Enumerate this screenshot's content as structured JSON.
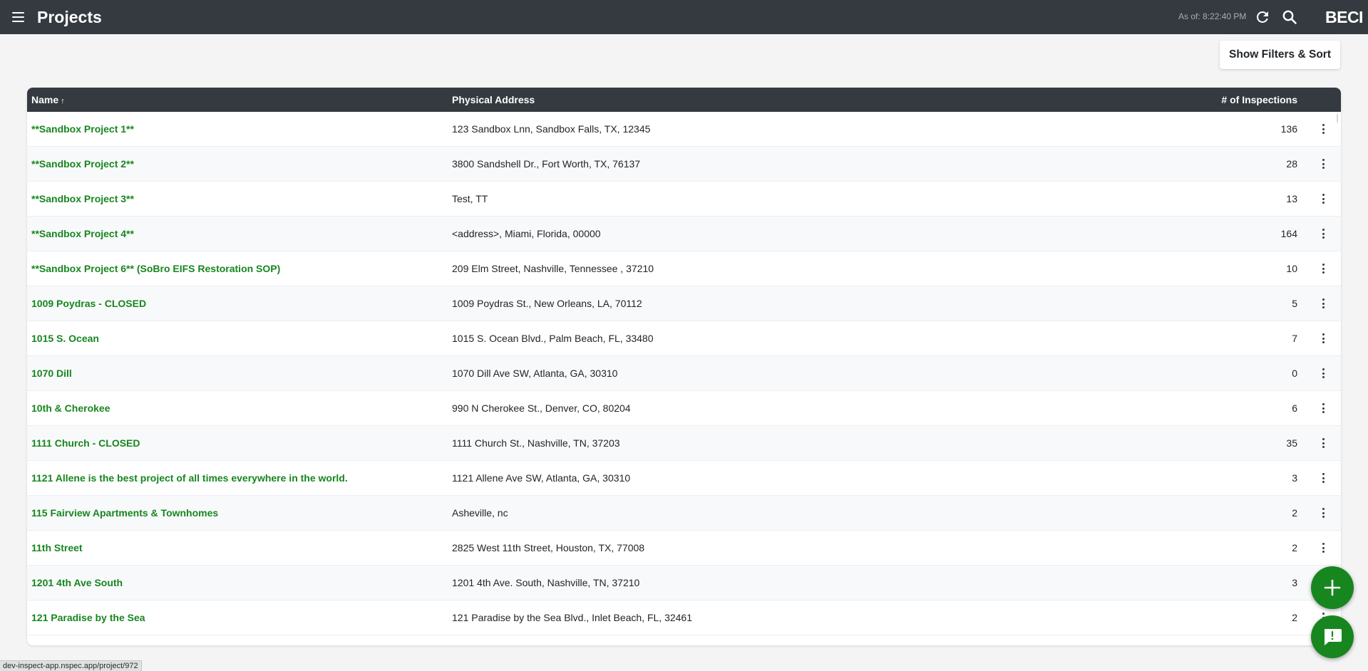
{
  "header": {
    "title": "Projects",
    "as_of": "As of: 8:22:40 PM",
    "brand": "BECI",
    "icons": {
      "menu": "hamburger-menu-icon",
      "refresh": "refresh-icon",
      "search": "search-icon"
    }
  },
  "toolbar": {
    "filters_label": "Show Filters & Sort"
  },
  "table": {
    "columns": {
      "name": "Name",
      "address": "Physical Address",
      "count": "# of Inspections"
    },
    "sort_indicator": "↑",
    "rows": [
      {
        "name": "**Sandbox Project 1**",
        "address": "123 Sandbox Lnn, Sandbox Falls, TX, 12345",
        "count": "136"
      },
      {
        "name": "**Sandbox Project 2**",
        "address": "3800 Sandshell Dr., Fort Worth, TX, 76137",
        "count": "28"
      },
      {
        "name": "**Sandbox Project 3**",
        "address": "Test, TT",
        "count": "13"
      },
      {
        "name": "**Sandbox Project 4**",
        "address": "<address>, Miami, Florida, 00000",
        "count": "164"
      },
      {
        "name": "**Sandbox Project 6** (SoBro EIFS Restoration SOP)",
        "address": "209 Elm Street, Nashville, Tennessee , 37210",
        "count": "10"
      },
      {
        "name": "1009 Poydras - CLOSED",
        "address": "1009 Poydras St., New Orleans, LA, 70112",
        "count": "5"
      },
      {
        "name": "1015 S. Ocean",
        "address": "1015 S. Ocean Blvd., Palm Beach, FL, 33480",
        "count": "7"
      },
      {
        "name": "1070 Dill",
        "address": "1070 Dill Ave SW, Atlanta, GA, 30310",
        "count": "0"
      },
      {
        "name": "10th & Cherokee",
        "address": "990 N Cherokee St., Denver, CO, 80204",
        "count": "6"
      },
      {
        "name": "1111 Church - CLOSED",
        "address": "1111 Church St., Nashville, TN, 37203",
        "count": "35"
      },
      {
        "name": "1121 Allene is the best project of all times everywhere in the world.",
        "address": "1121 Allene Ave SW, Atlanta, GA, 30310",
        "count": "3"
      },
      {
        "name": "115 Fairview Apartments & Townhomes",
        "address": "Asheville, nc",
        "count": "2"
      },
      {
        "name": "11th Street",
        "address": "2825 West 11th Street, Houston, TX, 77008",
        "count": "2"
      },
      {
        "name": "1201 4th Ave South",
        "address": "1201 4th Ave. South, Nashville, TN, 37210",
        "count": "3"
      },
      {
        "name": "121 Paradise by the Sea",
        "address": "121 Paradise by the Sea Blvd., Inlet Beach, FL, 32461",
        "count": "2"
      }
    ],
    "row_action_icon": "more-vertical-icon"
  },
  "fabs": {
    "add_icon": "plus-icon",
    "chat_icon": "chat-feedback-icon"
  },
  "status_bar": {
    "url": "dev-inspect-app.nspec.app/project/972"
  },
  "colors": {
    "topbar": "#343a40",
    "accent_green": "#17861f",
    "page_bg": "#f4f4f4"
  }
}
